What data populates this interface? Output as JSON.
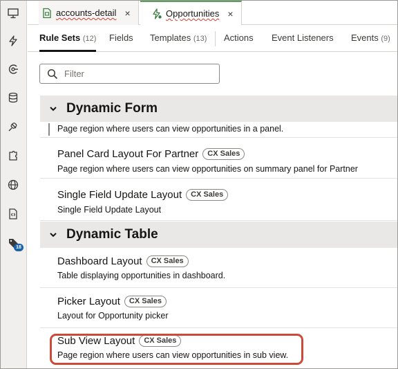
{
  "file_tabs": [
    {
      "label": "accounts-detail",
      "close": "×",
      "icon": "page-icon"
    },
    {
      "label": "Opportunities",
      "close": "×",
      "icon": "lightning-icon"
    }
  ],
  "rail": {
    "icons": [
      "monitor-icon",
      "lightning-icon",
      "service-icon",
      "database-icon",
      "plug-icon",
      "puzzle-icon",
      "globe-icon",
      "source-file-icon",
      "tag-icon"
    ],
    "tag_badge": "18"
  },
  "designer_tabs": [
    {
      "label": "Rule Sets",
      "count": "(12)",
      "active": true
    },
    {
      "label": "Fields",
      "count": ""
    },
    {
      "label": "Templates",
      "count": "(13)"
    },
    {
      "label": "Actions",
      "count": ""
    },
    {
      "label": "Event Listeners",
      "count": ""
    },
    {
      "label": "Events",
      "count": "(9)"
    }
  ],
  "filter": {
    "placeholder": "Filter",
    "value": ""
  },
  "groups": [
    {
      "title": "Dynamic Form",
      "items": [
        {
          "title": "",
          "tag": "",
          "desc": "Page region where users can view opportunities in a panel."
        },
        {
          "title": "Panel Card Layout For Partner",
          "tag": "CX Sales",
          "desc": "Page region where users can view opportunities on summary panel for Partner"
        },
        {
          "title": "Single Field Update Layout",
          "tag": "CX Sales",
          "desc": "Single Field Update Layout"
        }
      ]
    },
    {
      "title": "Dynamic Table",
      "items": [
        {
          "title": "Dashboard Layout",
          "tag": "CX Sales",
          "desc": "Table displaying opportunities in dashboard."
        },
        {
          "title": "Picker Layout",
          "tag": "CX Sales",
          "desc": "Layout for Opportunity picker"
        },
        {
          "title": "Sub View Layout",
          "tag": "CX Sales",
          "desc": "Page region where users can view opportunities in sub view."
        }
      ]
    }
  ],
  "colors": {
    "accent_active_tab": "#58a05c",
    "highlight": "#c94b38",
    "badge": "#1b63a8"
  }
}
